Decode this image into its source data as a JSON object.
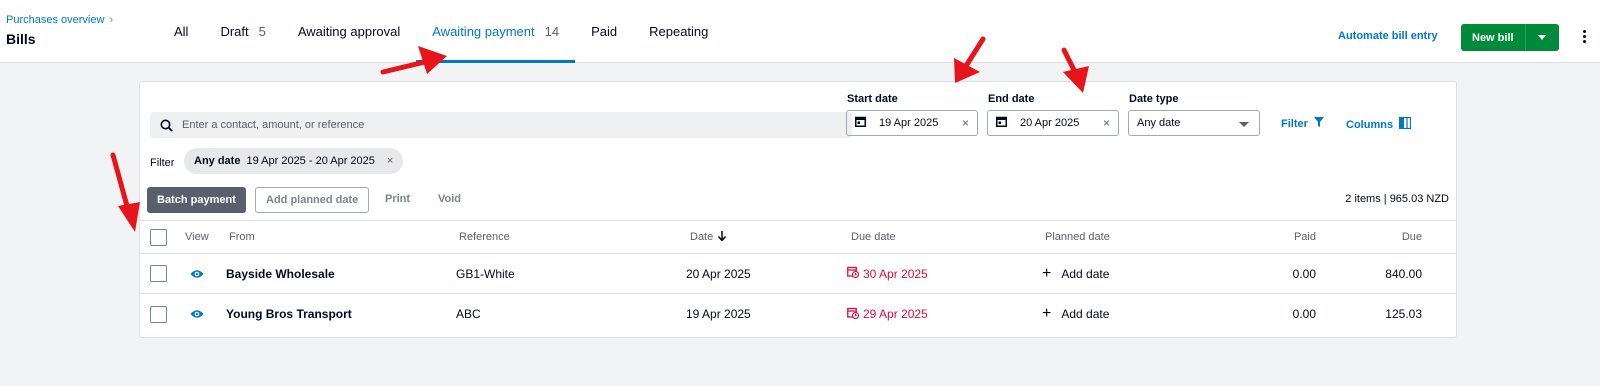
{
  "header": {
    "breadcrumb": "Purchases overview",
    "title": "Bills",
    "tabs": [
      {
        "label": "All",
        "count": ""
      },
      {
        "label": "Draft",
        "count": "5"
      },
      {
        "label": "Awaiting approval",
        "count": ""
      },
      {
        "label": "Awaiting payment",
        "count": "14"
      },
      {
        "label": "Paid",
        "count": ""
      },
      {
        "label": "Repeating",
        "count": ""
      }
    ],
    "automate_label": "Automate bill entry",
    "new_bill_label": "New bill"
  },
  "filters": {
    "search_placeholder": "Enter a contact, amount, or reference",
    "start_date_label": "Start date",
    "start_date": "19 Apr 2025",
    "end_date_label": "End date",
    "end_date": "20 Apr 2025",
    "date_type_label": "Date type",
    "date_type": "Any date",
    "filter_button": "Filter",
    "columns_button": "Columns",
    "filter_label": "Filter",
    "chip_bold": "Any date",
    "chip_range": "19 Apr 2025 - 20 Apr 2025"
  },
  "actions": {
    "batch_payment": "Batch payment",
    "add_planned_date": "Add planned date",
    "print": "Print",
    "void": "Void",
    "summary": "2 items | 965.03 NZD"
  },
  "table": {
    "headers": {
      "view": "View",
      "from": "From",
      "reference": "Reference",
      "date": "Date",
      "due_date": "Due date",
      "planned_date": "Planned date",
      "paid": "Paid",
      "due": "Due"
    },
    "rows": [
      {
        "from": "Bayside Wholesale",
        "reference": "GB1-White",
        "date": "20 Apr 2025",
        "due_date": "30 Apr 2025",
        "planned": "Add date",
        "paid": "0.00",
        "due": "840.00"
      },
      {
        "from": "Young Bros Transport",
        "reference": "ABC",
        "date": "19 Apr 2025",
        "due_date": "29 Apr 2025",
        "planned": "Add date",
        "paid": "0.00",
        "due": "125.03"
      }
    ]
  },
  "colors": {
    "accent": "#0078c8",
    "primary_button": "#008a3c",
    "overdue": "#de0e40",
    "annotation_arrow": "#e8141b"
  }
}
